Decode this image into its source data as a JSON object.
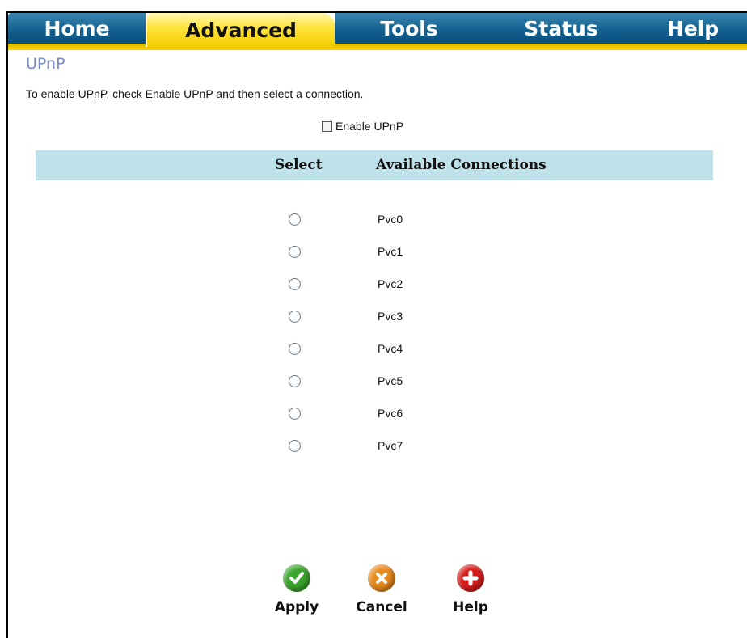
{
  "tabs": [
    {
      "label": "Home",
      "active": false
    },
    {
      "label": "Advanced",
      "active": true
    },
    {
      "label": "Tools",
      "active": false
    },
    {
      "label": "Status",
      "active": false
    },
    {
      "label": "Help",
      "active": false
    }
  ],
  "page": {
    "title": "UPnP",
    "intro": "To enable UPnP, check Enable UPnP and then select a connection.",
    "enable_label": "Enable UPnP",
    "enable_checked": false
  },
  "table": {
    "columns": [
      "Select",
      "Available Connections"
    ],
    "rows": [
      {
        "label": "Pvc0",
        "selected": false
      },
      {
        "label": "Pvc1",
        "selected": false
      },
      {
        "label": "Pvc2",
        "selected": false
      },
      {
        "label": "Pvc3",
        "selected": false
      },
      {
        "label": "Pvc4",
        "selected": false
      },
      {
        "label": "Pvc5",
        "selected": false
      },
      {
        "label": "Pvc6",
        "selected": false
      },
      {
        "label": "Pvc7",
        "selected": false
      }
    ]
  },
  "actions": {
    "apply_label": "Apply",
    "cancel_label": "Cancel",
    "help_label": "Help"
  },
  "colors": {
    "tab_blue": "#125e8c",
    "tab_active_yellow": "#ffe43a",
    "header_bar": "#bfe1e9",
    "title_color": "#7b8cc0",
    "apply_green": "#3aa52c",
    "cancel_orange": "#e98a1c",
    "help_red": "#d81d1d"
  },
  "icons": {
    "apply": "check-icon",
    "cancel": "x-icon",
    "help": "plus-icon"
  }
}
